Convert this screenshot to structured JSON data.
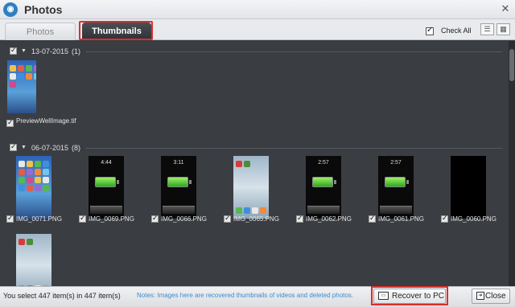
{
  "window": {
    "title": "Photos",
    "close_glyph": "✕"
  },
  "tabs": [
    {
      "label": "Photos",
      "active": false
    },
    {
      "label": "Thumbnails",
      "active": true
    }
  ],
  "toolbar": {
    "check_all_label": "Check All",
    "check_all_checked": true,
    "view_list_icon": "list-view-icon",
    "view_grid_icon": "calendar-view-icon"
  },
  "groups": [
    {
      "date": "13-07-2015",
      "count": "(1)",
      "checked": true,
      "items": [
        {
          "name": "PreviewWellImage.tif",
          "kind": "home",
          "checked": true
        }
      ]
    },
    {
      "date": "06-07-2015",
      "count": "(8)",
      "checked": true,
      "items": [
        {
          "name": "IMG_0071.PNG",
          "kind": "home",
          "checked": true
        },
        {
          "name": "IMG_0069.PNG",
          "kind": "lock",
          "time": "4:44",
          "checked": true
        },
        {
          "name": "IMG_0066.PNG",
          "kind": "lock",
          "time": "3:11",
          "checked": true
        },
        {
          "name": "IMG_0065.PNG",
          "kind": "pale",
          "checked": true
        },
        {
          "name": "IMG_0062.PNG",
          "kind": "lock",
          "time": "2:57",
          "checked": true
        },
        {
          "name": "IMG_0061.PNG",
          "kind": "lock",
          "time": "2:57",
          "checked": true
        },
        {
          "name": "IMG_0060.PNG",
          "kind": "black",
          "checked": true
        },
        {
          "name": "",
          "kind": "pale",
          "checked": false
        }
      ]
    }
  ],
  "footer": {
    "status": "You select 447 item(s) in 447 item(s)",
    "notes": "Notes: Images here are recovered thumbnails of videos and deleted photos.",
    "recover_label": "Recover to PC",
    "close_label": "Close"
  },
  "colors": {
    "accent_red": "#d9302b",
    "notes_blue": "#3b8bd0",
    "panel": "#3a3d42"
  }
}
